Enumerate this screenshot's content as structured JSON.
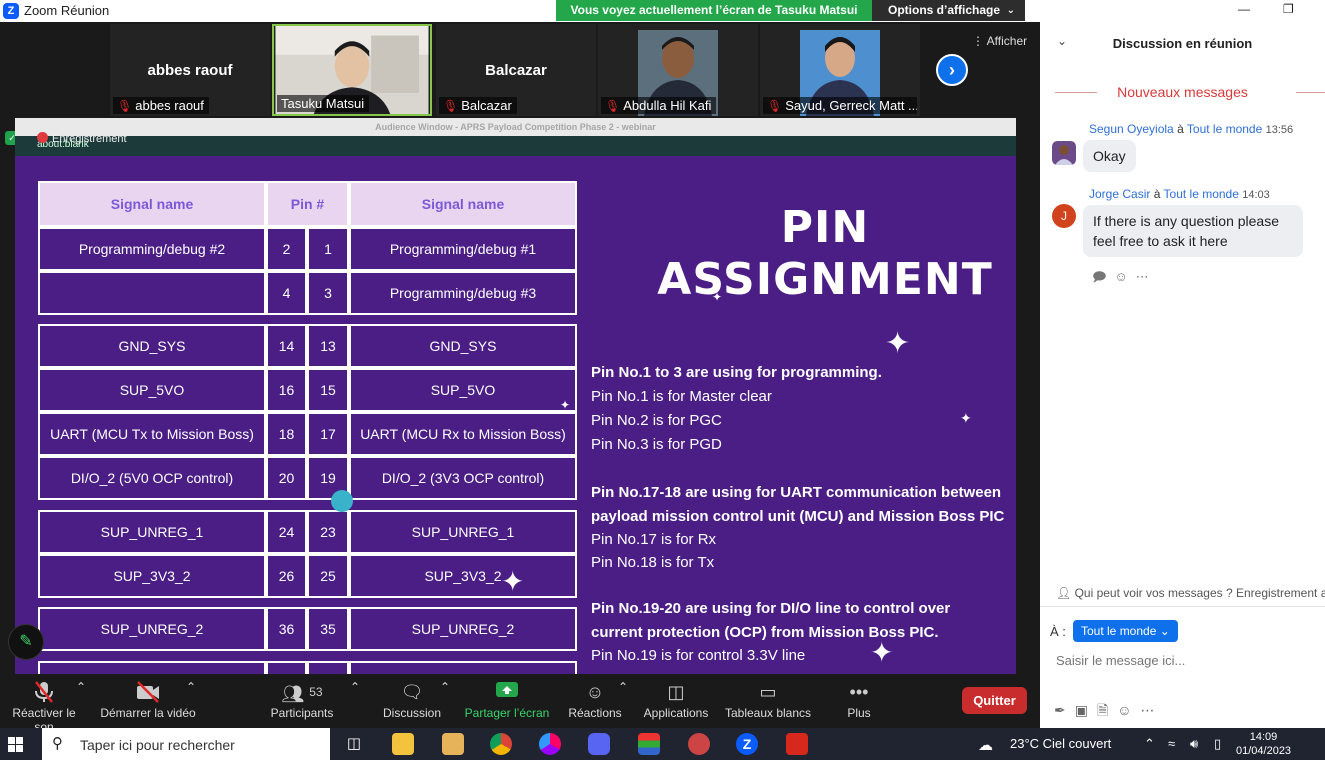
{
  "window": {
    "title": "Zoom Réunion"
  },
  "share_banner": {
    "text": "Vous voyez actuellement l’écran de Tasuku Matsui",
    "view_options": "Options d’affichage"
  },
  "gallery": {
    "show_label": "Afficher",
    "participants": [
      {
        "big_name": "abbes raouf",
        "label": "abbes raouf",
        "muted": true
      },
      {
        "big_name": "",
        "label": "Tasuku Matsui",
        "muted": false,
        "active": true
      },
      {
        "big_name": "Balcazar",
        "label": "Balcazar",
        "muted": true
      },
      {
        "big_name": "",
        "label": "Abdulla Hil Kafi",
        "muted": true
      },
      {
        "big_name": "",
        "label": "Sayud, Gerreck Matt ...",
        "muted": true
      }
    ]
  },
  "shared_window": {
    "title": "Audience Window - APRS Payload Competition Phase 2 - webinar",
    "url": "about:blank",
    "recording": "Enregistrement"
  },
  "slide": {
    "title_line1": "PIN",
    "title_line2": "ASSIGNMENT",
    "headers": [
      "Signal name",
      "Pin #",
      "Signal name"
    ],
    "rows": [
      {
        "left": "Programming/debug #2",
        "pin_l": "2",
        "pin_r": "1",
        "right": "Programming/debug #1"
      },
      {
        "left": "",
        "pin_l": "4",
        "pin_r": "3",
        "right": "Programming/debug #3"
      },
      {
        "left": "GND_SYS",
        "pin_l": "14",
        "pin_r": "13",
        "right": "GND_SYS"
      },
      {
        "left": "SUP_5VO",
        "pin_l": "16",
        "pin_r": "15",
        "right": "SUP_5VO"
      },
      {
        "left": "UART (MCU Tx to Mission Boss)",
        "pin_l": "18",
        "pin_r": "17",
        "right": "UART (MCU Rx to Mission Boss)"
      },
      {
        "left": "DI/O_2 (5V0 OCP control)",
        "pin_l": "20",
        "pin_r": "19",
        "right": "DI/O_2 (3V3 OCP control)"
      },
      {
        "left": "SUP_UNREG_1",
        "pin_l": "24",
        "pin_r": "23",
        "right": "SUP_UNREG_1"
      },
      {
        "left": "SUP_3V3_2",
        "pin_l": "26",
        "pin_r": "25",
        "right": "SUP_3V3_2"
      },
      {
        "left": "SUP_UNREG_2",
        "pin_l": "36",
        "pin_r": "35",
        "right": "SUP_UNREG_2"
      }
    ],
    "notes": [
      {
        "text": "Pin No.1 to 3 are using for programming.",
        "bold": true
      },
      {
        "text": "Pin No.1 is for Master clear",
        "bold": false
      },
      {
        "text": "Pin No.2 is for PGC",
        "bold": false
      },
      {
        "text": "Pin No.3 is for PGD",
        "bold": false
      },
      {
        "text": "Pin No.17-18 are using for UART communication between",
        "bold": true
      },
      {
        "text": "payload mission control unit (MCU) and Mission Boss PIC",
        "bold": true
      },
      {
        "text": "Pin No.17 is for Rx",
        "bold": false
      },
      {
        "text": "Pin No.18 is for Tx",
        "bold": false
      },
      {
        "text": "Pin No.19-20 are using for DI/O line to control over",
        "bold": true
      },
      {
        "text": "current protection (OCP) from Mission Boss PIC.",
        "bold": true
      },
      {
        "text": "Pin No.19 is for control 3.3V line",
        "bold": false
      }
    ]
  },
  "toolbar": {
    "unmute": "Réactiver le son",
    "start_video": "Démarrer la vidéo",
    "participants": "Participants",
    "participants_count": "53",
    "chat": "Discussion",
    "share": "Partager l’écran",
    "reactions": "Réactions",
    "apps": "Applications",
    "whiteboards": "Tableaux blancs",
    "more": "Plus",
    "quit": "Quitter"
  },
  "chat": {
    "title": "Discussion en réunion",
    "new_messages": "Nouveaux messages",
    "messages": [
      {
        "sender": "Segun Oyeyiola",
        "to": "Tout le monde",
        "time": "13:56",
        "text": "Okay"
      },
      {
        "sender": "Jorge Casir",
        "to": "Tout le monde",
        "time": "14:03",
        "text": "If there is any question please feel free to ask it here"
      }
    ],
    "to_word": "à",
    "who_can_see": "Qui peut voir vos messages ? Enregistrement ac",
    "to_label": "À :",
    "recipient": "Tout le monde",
    "input_placeholder": "Saisir le message ici..."
  },
  "taskbar": {
    "search_placeholder": "Taper ici pour rechercher",
    "weather": "23°C  Ciel couvert",
    "time": "14:09",
    "date": "01/04/2023"
  },
  "colors": {
    "slide_bg": "#4b1e86",
    "header_bg": "#ead5f0",
    "accent": "#0e71eb",
    "quit": "#c92c2c",
    "share_green": "#23a74a"
  }
}
